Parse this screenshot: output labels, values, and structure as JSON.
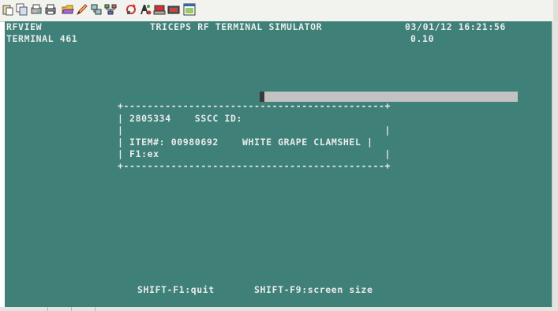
{
  "toolbar": {
    "icons": [
      "paste-icon",
      "copy-icon",
      "print-preview-icon",
      "print-icon",
      "open-folder-icon",
      "edit-pencil-icon",
      "network-icon",
      "tree-icon",
      "refresh-icon",
      "font-icon",
      "keyboard-icon",
      "screen-icon",
      "window-icon"
    ]
  },
  "header": {
    "app_name": "RFVIEW",
    "terminal_id": "TERMINAL 461",
    "title": "TRICEPS RF TERMINAL SIMULATOR",
    "datetime": "03/01/12 16:21:56",
    "version": "0.10"
  },
  "dialog": {
    "border_top": "+--------------------------------------------+",
    "row1_lead": "| 2805334    SSCC ID: ",
    "row2": "|                                            |",
    "row3": "| ITEM#: 00980692    WHITE GRAPE CLAMSHEL |",
    "row4": "| F1:ex                                      |",
    "border_bottom": "+--------------------------------------------+",
    "sscc_value": ""
  },
  "footer": {
    "quit_hint": "SHIFT-F1:quit",
    "screen_size_hint": "SHIFT-F9:screen size"
  },
  "colors": {
    "terminal_bg": "#3f8079",
    "terminal_text": "#e9ecea",
    "input_field": "#c2c2c2"
  }
}
